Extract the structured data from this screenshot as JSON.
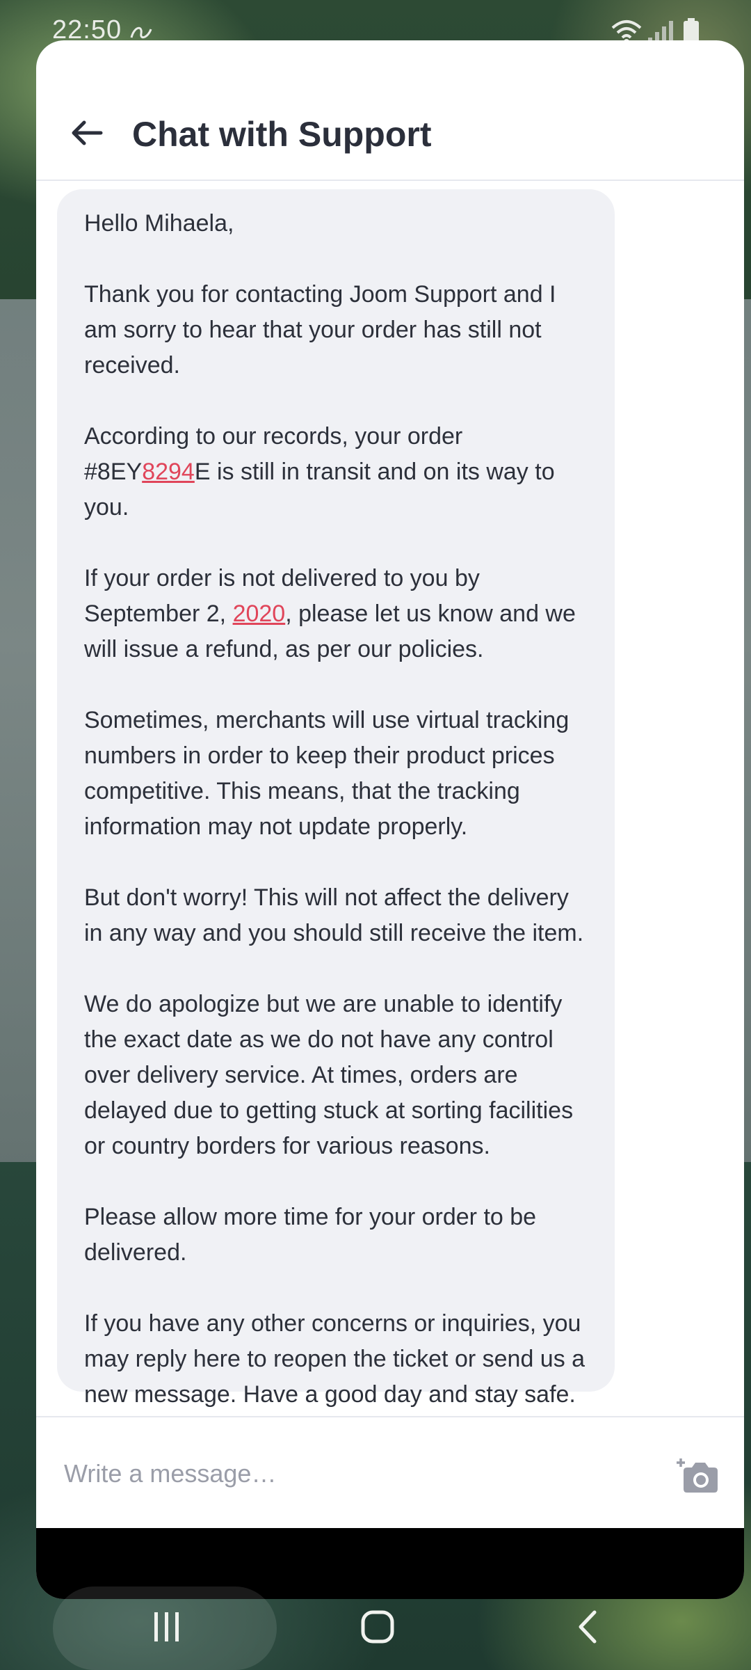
{
  "status_bar": {
    "time": "22:50",
    "icons": [
      "notification-icon",
      "wifi-icon",
      "signal-icon",
      "battery-icon"
    ]
  },
  "header": {
    "back_icon": "arrow-left-icon",
    "title": "Chat with Support"
  },
  "message": {
    "greeting": "Hello Mihaela,",
    "p1": "Thank you for contacting Joom Support and I am sorry to hear that your order has still not received.",
    "p2_before": "According to our records, your order #8EY",
    "p2_link": "8294",
    "p2_after": "E is still in transit and on its way to you.",
    "p3_before": "If your order is not delivered to you by September 2, ",
    "p3_link": "2020",
    "p3_after": ", please let us know and we will issue a refund, as per our policies.",
    "p4": "Sometimes, merchants will use virtual tracking numbers in order to keep their product prices competitive. This means, that the tracking information may not update properly.",
    "p5": "But don't worry! This will not affect the delivery in any way and you should still receive the item.",
    "p6": "We do apologize but we are unable to identify the exact date as we do not have any control over delivery service. At times, orders are delayed due to getting stuck at sorting facilities or country borders for various reasons.",
    "p7": "Please allow more time for your order to be delivered.",
    "p8": "If you have any other concerns or inquiries, you may reply here to reopen the ticket or send us a new message. Have a good day and stay safe."
  },
  "composer": {
    "placeholder": "Write a message…",
    "value": "",
    "camera_icon": "add-photo-camera-icon"
  },
  "nav_bar": {
    "icons": [
      "recent-apps-icon",
      "home-icon",
      "back-icon"
    ]
  },
  "colors": {
    "accent_link": "#e0455a",
    "bubble_bg": "#f0f1f5",
    "text": "#2c303a"
  }
}
